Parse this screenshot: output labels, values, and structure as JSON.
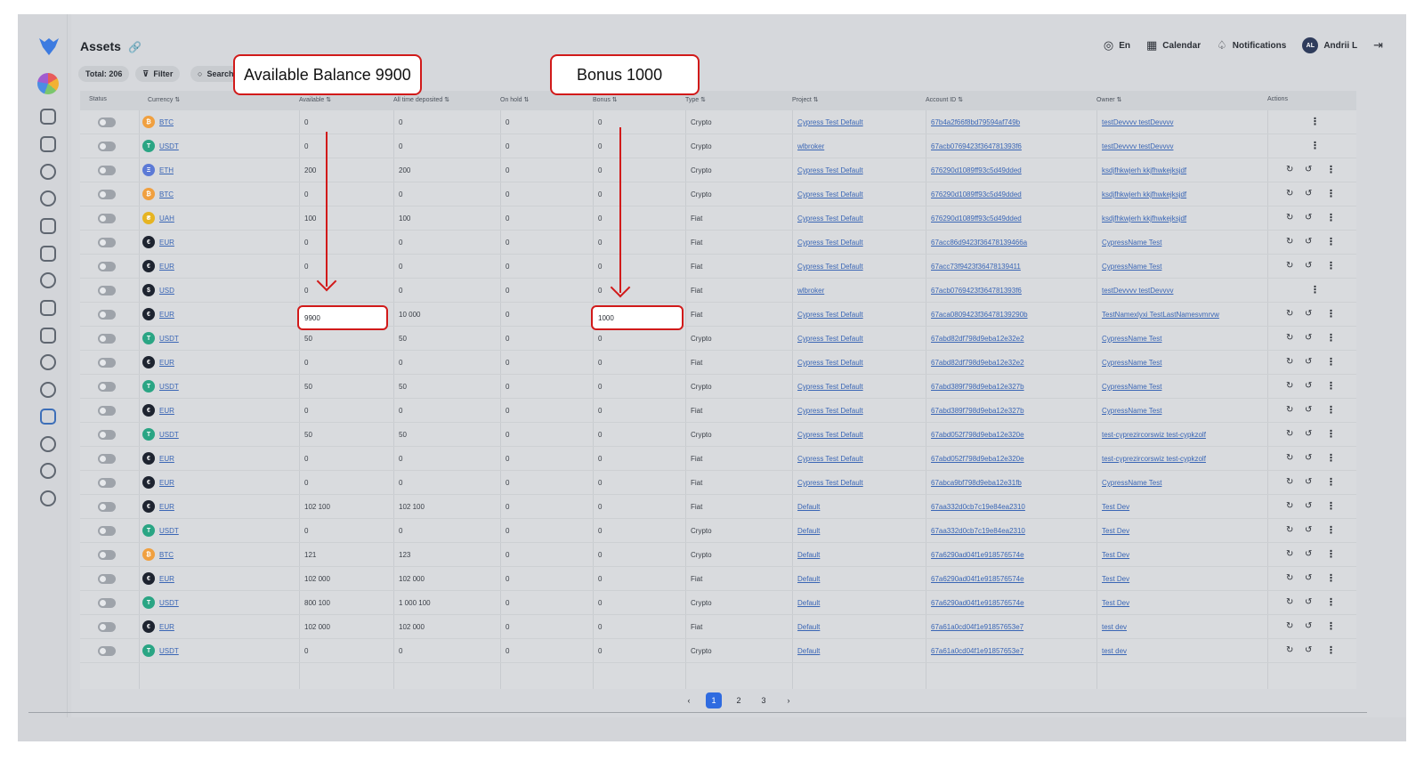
{
  "page": {
    "title": "Assets"
  },
  "topbar": {
    "language": "En",
    "calendar": "Calendar",
    "notifications": "Notifications",
    "avatar_initials": "AL",
    "user_name": "Andrii L"
  },
  "toolbar": {
    "total": "Total: 206",
    "filter": "Filter",
    "search_placeholder": "Search"
  },
  "table": {
    "headers": [
      "Status",
      "Currency",
      "Available",
      "All time deposited",
      "On hold",
      "Bonus",
      "Type",
      "Project",
      "Account ID",
      "Owner",
      "Actions"
    ],
    "rows": [
      {
        "currency": "BTC",
        "available": "0",
        "deposited": "0",
        "on_hold": "0",
        "bonus": "0",
        "type": "Crypto",
        "project": "Cypress Test Default",
        "account_id": "67b4a2f66f8bd79594af749b",
        "owner": "testDevvvv testDevvvv",
        "actions": "kebab"
      },
      {
        "currency": "USDT",
        "available": "0",
        "deposited": "0",
        "on_hold": "0",
        "bonus": "0",
        "type": "Crypto",
        "project": "wlbroker",
        "account_id": "67acb0769423f364781393f6",
        "owner": "testDevvvv testDevvvv",
        "actions": "kebab"
      },
      {
        "currency": "ETH",
        "available": "200",
        "deposited": "200",
        "on_hold": "0",
        "bonus": "0",
        "type": "Crypto",
        "project": "Cypress Test Default",
        "account_id": "676290d1089ff93c5d49dded",
        "owner": "ksdjfhkwjerh kkjfhwkejksjdf",
        "actions": "full"
      },
      {
        "currency": "BTC",
        "available": "0",
        "deposited": "0",
        "on_hold": "0",
        "bonus": "0",
        "type": "Crypto",
        "project": "Cypress Test Default",
        "account_id": "676290d1089ff93c5d49dded",
        "owner": "ksdjfhkwjerh kkjfhwkejksjdf",
        "actions": "full"
      },
      {
        "currency": "UAH",
        "available": "100",
        "deposited": "100",
        "on_hold": "0",
        "bonus": "0",
        "type": "Fiat",
        "project": "Cypress Test Default",
        "account_id": "676290d1089ff93c5d49dded",
        "owner": "ksdjfhkwjerh kkjfhwkejksjdf",
        "actions": "full"
      },
      {
        "currency": "EUR",
        "available": "0",
        "deposited": "0",
        "on_hold": "0",
        "bonus": "0",
        "type": "Fiat",
        "project": "Cypress Test Default",
        "account_id": "67acc86d9423f36478139466a",
        "owner": "CypressName Test",
        "actions": "full"
      },
      {
        "currency": "EUR",
        "available": "0",
        "deposited": "0",
        "on_hold": "0",
        "bonus": "0",
        "type": "Fiat",
        "project": "Cypress Test Default",
        "account_id": "67acc73f9423f36478139411",
        "owner": "CypressName Test",
        "actions": "full"
      },
      {
        "currency": "USD",
        "available": "0",
        "deposited": "0",
        "on_hold": "0",
        "bonus": "0",
        "type": "Fiat",
        "project": "wlbroker",
        "account_id": "67acb0769423f364781393f6",
        "owner": "testDevvvv testDevvvv",
        "actions": "kebab"
      },
      {
        "currency": "EUR",
        "available": "9900",
        "deposited": "10 000",
        "on_hold": "0",
        "bonus": "1000",
        "type": "Fiat",
        "project": "Cypress Test Default",
        "account_id": "67aca0809423f36478139290b",
        "owner": "TestNamexlyxi TestLastNamesvmrvw",
        "actions": "full",
        "highlight": true
      },
      {
        "currency": "USDT",
        "available": "50",
        "deposited": "50",
        "on_hold": "0",
        "bonus": "0",
        "type": "Crypto",
        "project": "Cypress Test Default",
        "account_id": "67abd82df798d9eba12e32e2",
        "owner": "CypressName Test",
        "actions": "full"
      },
      {
        "currency": "EUR",
        "available": "0",
        "deposited": "0",
        "on_hold": "0",
        "bonus": "0",
        "type": "Fiat",
        "project": "Cypress Test Default",
        "account_id": "67abd82df798d9eba12e32e2",
        "owner": "CypressName Test",
        "actions": "full"
      },
      {
        "currency": "USDT",
        "available": "50",
        "deposited": "50",
        "on_hold": "0",
        "bonus": "0",
        "type": "Crypto",
        "project": "Cypress Test Default",
        "account_id": "67abd389f798d9eba12e327b",
        "owner": "CypressName Test",
        "actions": "full"
      },
      {
        "currency": "EUR",
        "available": "0",
        "deposited": "0",
        "on_hold": "0",
        "bonus": "0",
        "type": "Fiat",
        "project": "Cypress Test Default",
        "account_id": "67abd389f798d9eba12e327b",
        "owner": "CypressName Test",
        "actions": "full"
      },
      {
        "currency": "USDT",
        "available": "50",
        "deposited": "50",
        "on_hold": "0",
        "bonus": "0",
        "type": "Crypto",
        "project": "Cypress Test Default",
        "account_id": "67abd052f798d9eba12e320e",
        "owner": "test-cyprezircorswiz test-cypkzolf",
        "actions": "full"
      },
      {
        "currency": "EUR",
        "available": "0",
        "deposited": "0",
        "on_hold": "0",
        "bonus": "0",
        "type": "Fiat",
        "project": "Cypress Test Default",
        "account_id": "67abd052f798d9eba12e320e",
        "owner": "test-cyprezircorswiz test-cypkzolf",
        "actions": "full"
      },
      {
        "currency": "EUR",
        "available": "0",
        "deposited": "0",
        "on_hold": "0",
        "bonus": "0",
        "type": "Fiat",
        "project": "Cypress Test Default",
        "account_id": "67abca9bf798d9eba12e31fb",
        "owner": "CypressName Test",
        "actions": "full"
      },
      {
        "currency": "EUR",
        "available": "102 100",
        "deposited": "102 100",
        "on_hold": "0",
        "bonus": "0",
        "type": "Fiat",
        "project": "Default",
        "account_id": "67aa332d0cb7c19e84ea2310",
        "owner": "Test Dev",
        "actions": "full"
      },
      {
        "currency": "USDT",
        "available": "0",
        "deposited": "0",
        "on_hold": "0",
        "bonus": "0",
        "type": "Crypto",
        "project": "Default",
        "account_id": "67aa332d0cb7c19e84ea2310",
        "owner": "Test Dev",
        "actions": "full"
      },
      {
        "currency": "BTC",
        "available": "121",
        "deposited": "123",
        "on_hold": "0",
        "bonus": "0",
        "type": "Crypto",
        "project": "Default",
        "account_id": "67a6290ad04f1e918576574e",
        "owner": "Test Dev",
        "actions": "full"
      },
      {
        "currency": "EUR",
        "available": "102 000",
        "deposited": "102 000",
        "on_hold": "0",
        "bonus": "0",
        "type": "Fiat",
        "project": "Default",
        "account_id": "67a6290ad04f1e918576574e",
        "owner": "Test Dev",
        "actions": "full"
      },
      {
        "currency": "USDT",
        "available": "800 100",
        "deposited": "1 000 100",
        "on_hold": "0",
        "bonus": "0",
        "type": "Crypto",
        "project": "Default",
        "account_id": "67a6290ad04f1e918576574e",
        "owner": "Test Dev",
        "actions": "full"
      },
      {
        "currency": "EUR",
        "available": "102 000",
        "deposited": "102 000",
        "on_hold": "0",
        "bonus": "0",
        "type": "Fiat",
        "project": "Default",
        "account_id": "67a61a0cd04f1e91857653e7",
        "owner": "test dev",
        "actions": "full"
      },
      {
        "currency": "USDT",
        "available": "0",
        "deposited": "0",
        "on_hold": "0",
        "bonus": "0",
        "type": "Crypto",
        "project": "Default",
        "account_id": "67a61a0cd04f1e91857653e7",
        "owner": "test dev",
        "actions": "full"
      }
    ]
  },
  "coins": {
    "BTC": {
      "color": "#f0a040",
      "glyph": "₿"
    },
    "USDT": {
      "color": "#2aa584",
      "glyph": "T"
    },
    "ETH": {
      "color": "#5c7ad6",
      "glyph": "Ξ"
    },
    "UAH": {
      "color": "#e6b422",
      "glyph": "₴"
    },
    "EUR": {
      "color": "#1e2430",
      "glyph": "€"
    },
    "USD": {
      "color": "#1e2430",
      "glyph": "$"
    }
  },
  "pagination": {
    "prev": "‹",
    "pages": [
      "1",
      "2",
      "3"
    ],
    "next": "›"
  },
  "callouts": {
    "available": "Available Balance 9900",
    "bonus": "Bonus 1000"
  }
}
